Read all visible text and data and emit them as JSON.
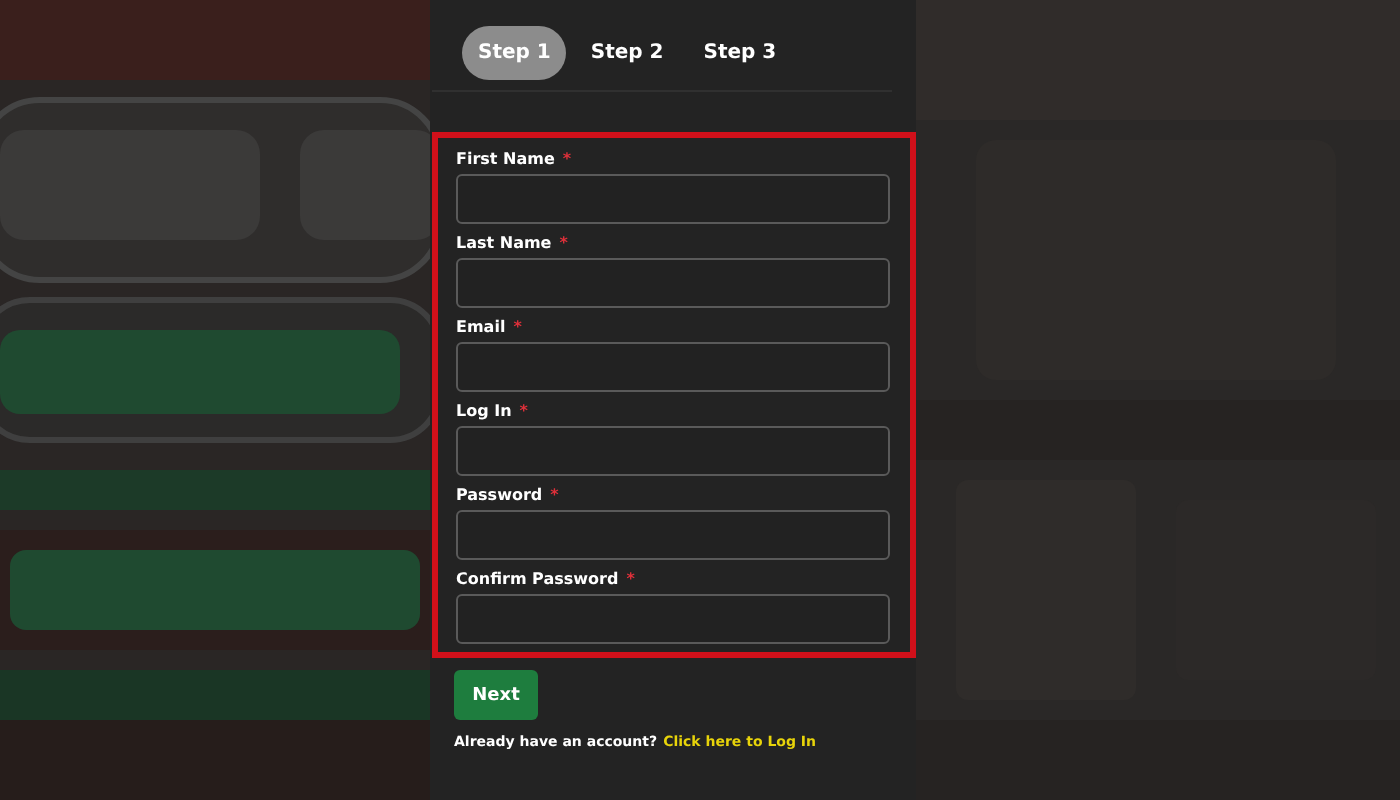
{
  "steps": [
    {
      "label": "Step 1",
      "selected": true
    },
    {
      "label": "Step 2",
      "selected": false
    },
    {
      "label": "Step 3",
      "selected": false
    }
  ],
  "fields": [
    {
      "label": "First Name",
      "required_mark": "*"
    },
    {
      "label": "Last Name",
      "required_mark": "*"
    },
    {
      "label": "Email",
      "required_mark": "*"
    },
    {
      "label": "Log In",
      "required_mark": "*"
    },
    {
      "label": "Password",
      "required_mark": "*"
    },
    {
      "label": "Confirm Password",
      "required_mark": "*"
    }
  ],
  "next_button": "Next",
  "login_prompt": {
    "text": "Already have an account?",
    "link": "Click here to Log In"
  }
}
